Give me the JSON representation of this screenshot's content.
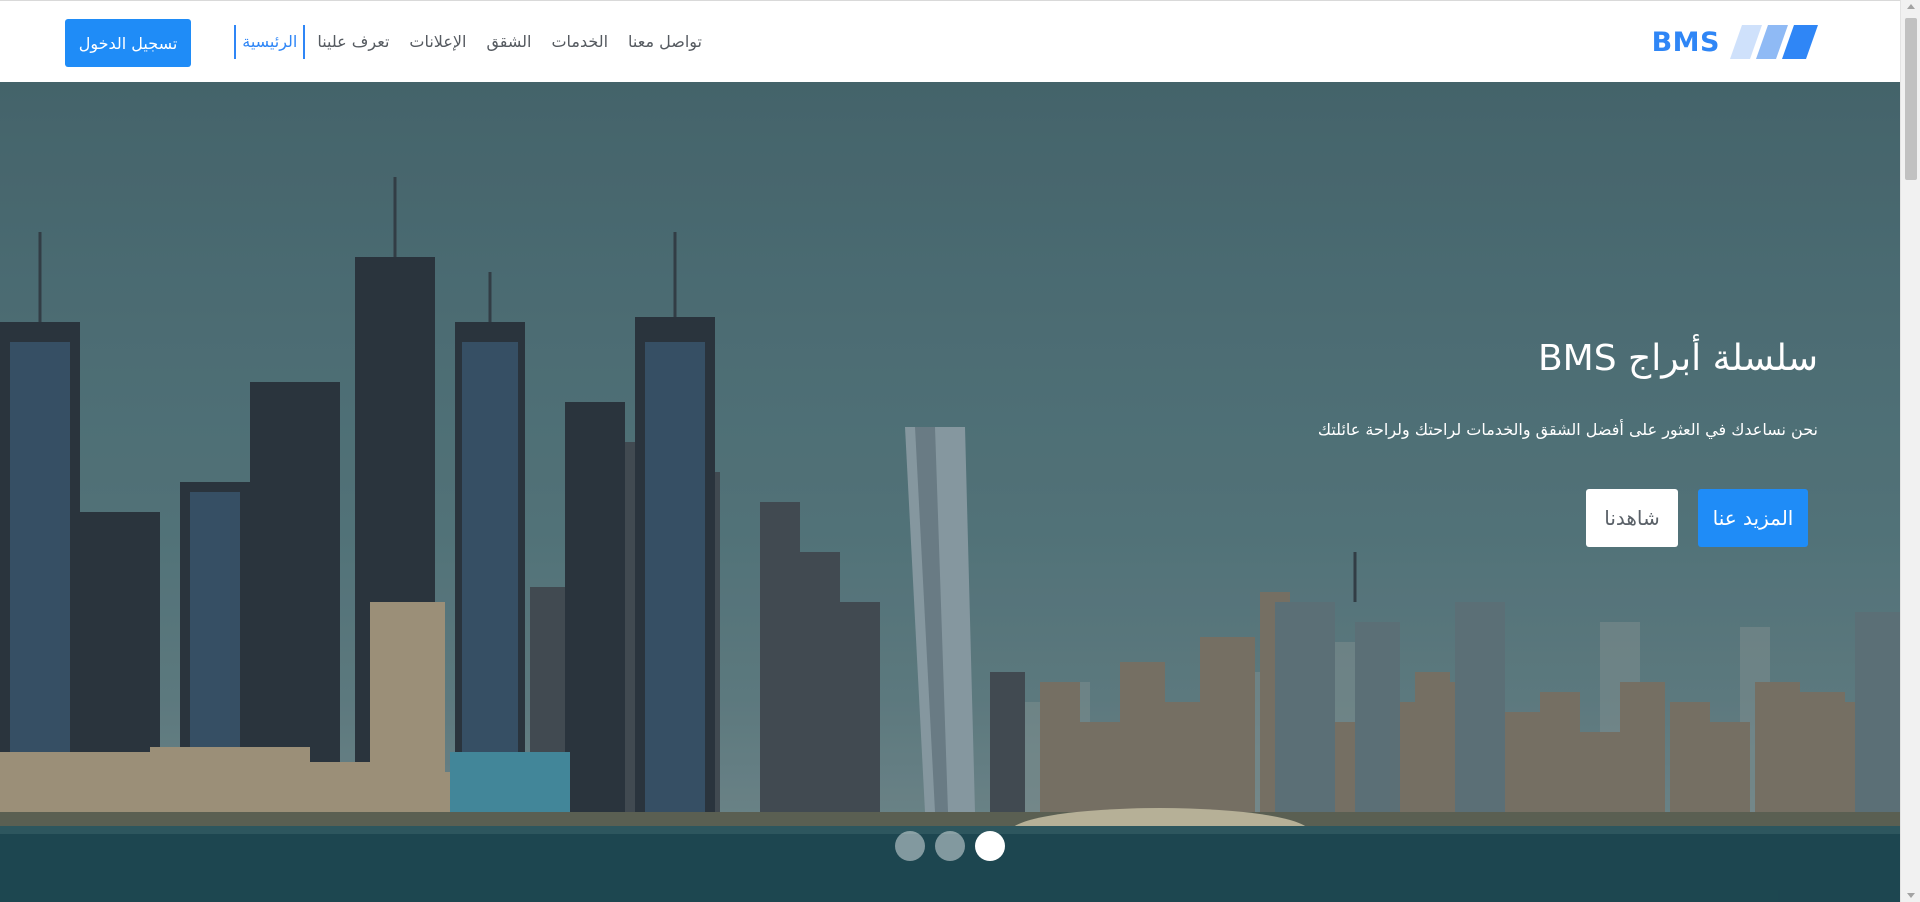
{
  "navbar": {
    "brand": "BMS",
    "links": [
      {
        "label": "الرئيسية",
        "active": true
      },
      {
        "label": "تعرف علينا",
        "active": false
      },
      {
        "label": "الإعلانات",
        "active": false
      },
      {
        "label": "الشقق",
        "active": false
      },
      {
        "label": "الخدمات",
        "active": false
      },
      {
        "label": "تواصل معنا",
        "active": false
      }
    ],
    "login_label": "تسجيل الدخول"
  },
  "hero": {
    "title": "سلسلة أبراج BMS",
    "subtitle": "نحن نساعدك في العثور على أفضل الشقق والخدمات لراحتك ولراحة عائلتك",
    "primary_button": "المزيد عنا",
    "secondary_button": "شاهدنا",
    "slides_count": 3,
    "active_slide": 3
  },
  "colors": {
    "accent": "#1f8cf7",
    "brand": "#2f86f6",
    "nav_text": "#555a60",
    "white": "#ffffff"
  },
  "icons": {
    "brand_logo": "stripes-logo-icon"
  }
}
